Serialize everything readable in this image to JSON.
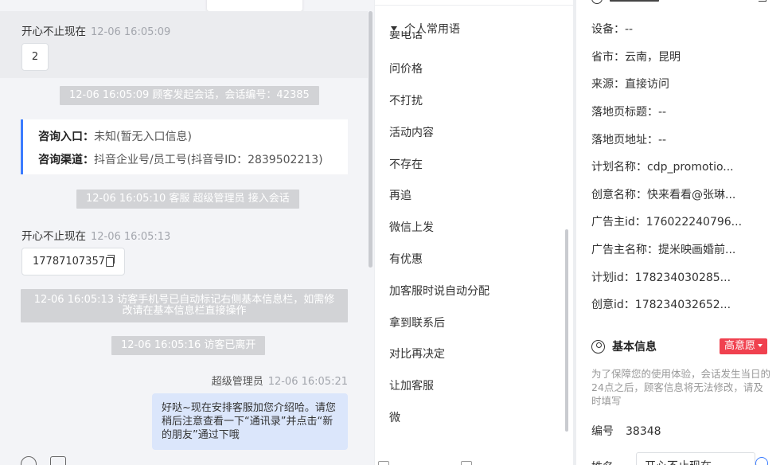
{
  "chat": {
    "messages": [
      {
        "sender": "开心不止现在",
        "time": "12-06 16:05:09",
        "text": "2"
      },
      {
        "sender": "开心不止现在",
        "time": "12-06 16:05:13",
        "text": "17787107357"
      }
    ],
    "system": {
      "start": "12-06 16:05:09 顾客发起会话，会话编号：42385",
      "accept": "12-06 16:05:10 客服 超级管理员 接入会话",
      "auto_tag": "12-06 16:05:13 访客手机号已自动标记右侧基本信息栏，如需修改请在基本信息栏直接操作",
      "left": "12-06 16:05:16 访客已离开"
    },
    "info_card": {
      "entry_label": "咨询入口：",
      "entry_value": "未知(暂无入口信息)",
      "channel_label": "咨询渠道：",
      "channel_value": "抖音企业号/员工号(抖音号ID：2839502213)"
    },
    "agent": {
      "name": "超级管理员",
      "time": "12-06 16:05:21",
      "text": "好哒~现在安排客服加您介绍哈。请您稍后注意查看一下“通讯录”并点击“新的朋友”通过下哦"
    }
  },
  "phrases": {
    "group_title": "个人常用语",
    "peek_item": "要电话",
    "items": [
      "问价格",
      "不打扰",
      "活动内容",
      "不存在",
      "再追",
      "微信上发",
      "有优惠",
      "加客服时说自动分配",
      "拿到联系后",
      "对比再决定",
      "让加客服",
      "微"
    ]
  },
  "info": {
    "fields": [
      {
        "label": "设备：",
        "value": "--"
      },
      {
        "label": "省市：",
        "value": "云南，昆明"
      },
      {
        "label": "来源：",
        "value": "直接访问"
      },
      {
        "label": "落地页标题：",
        "value": "--"
      },
      {
        "label": "落地页地址：",
        "value": "--"
      },
      {
        "label": "计划名称：",
        "value": "cdp_promotio..."
      },
      {
        "label": "创意名称：",
        "value": "快来看看@张琳..."
      },
      {
        "label": "广告主id：",
        "value": "176022240796..."
      },
      {
        "label": "广告主名称：",
        "value": "提米映画婚前..."
      },
      {
        "label": "计划id：",
        "value": "178234030285..."
      },
      {
        "label": "创意id：",
        "value": "178234032652..."
      }
    ],
    "basic_title": "基本信息",
    "intent_badge": "高意愿",
    "note": "为了保障您的使用体验，会话发生当日的24点之后，顾客信息将无法修改，请及时填写",
    "number_label": "编号",
    "number_value": "38348",
    "name_label": "姓名",
    "name_value": "开心不止现在"
  }
}
